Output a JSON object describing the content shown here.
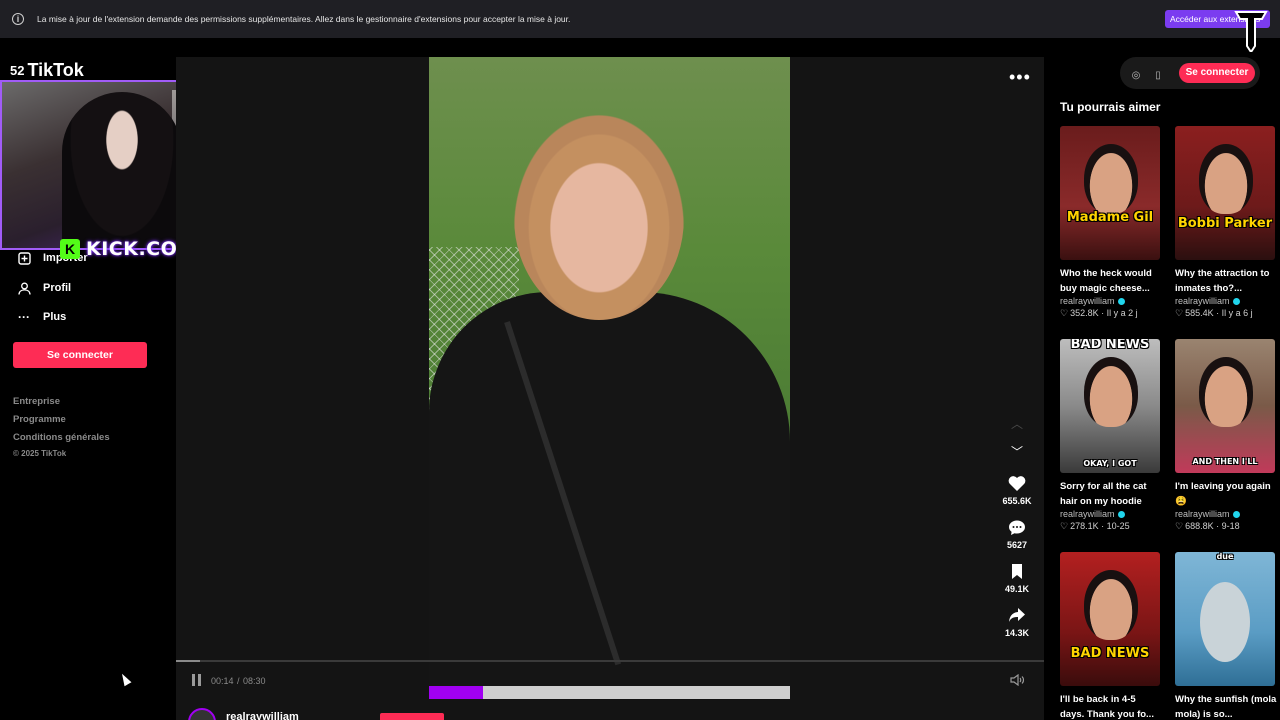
{
  "infobar": {
    "icon": "info-icon",
    "message": "La mise à jour de l'extension demande des permissions supplémentaires. Allez dans le gestionnaire d'extensions pour accepter la mise à jour.",
    "button_label": "Accéder aux extensions"
  },
  "sidebar": {
    "count": "52",
    "logo": "TikTok",
    "items": [
      {
        "label": "Importer",
        "icon": "plus-square-icon"
      },
      {
        "label": "Profil",
        "icon": "person-icon"
      },
      {
        "label": "Plus",
        "icon": "more-dots-icon"
      }
    ],
    "login_label": "Se connecter",
    "footer_links": [
      "Entreprise",
      "Programme",
      "Conditions générales"
    ],
    "copyright": "© 2025 TikTok"
  },
  "webcam": {
    "tag": "KICK.COM/ZARIEE",
    "kick_glyph": "K"
  },
  "player": {
    "time_current": "00:14",
    "time_sep": "/",
    "time_total": "08:30",
    "progress": 0.028,
    "overlay_progress": 0.15,
    "actions": [
      {
        "icon": "heart-icon",
        "count": "655.6K"
      },
      {
        "icon": "comment-icon",
        "count": "5627"
      },
      {
        "icon": "bookmark-icon",
        "count": "49.1K"
      },
      {
        "icon": "share-icon",
        "count": "14.3K"
      }
    ],
    "author": "realraywilliam"
  },
  "right_panel": {
    "login_label": "Se connecter",
    "section_title": "Tu pourrais aimer",
    "videos": [
      {
        "thumb_text": "Madame Gil",
        "title": "Who the heck would buy magic cheese...",
        "author": "realraywilliam",
        "likes": "352.8K",
        "date": "Il y a 2 j"
      },
      {
        "thumb_text": "Bobbi Parker",
        "title": "Why the attraction to inmates tho?...",
        "author": "realraywilliam",
        "likes": "585.4K",
        "date": "Il y a 6 j"
      },
      {
        "thumb_text": "BAD NEWS",
        "thumb_sub": "OKAY, I GOT",
        "title": "Sorry for all the cat hair on my hoodie",
        "author": "realraywilliam",
        "likes": "278.1K",
        "date": "10-25"
      },
      {
        "thumb_text": "AND THEN I'LL",
        "title": "I'm leaving you again 😩",
        "author": "realraywilliam",
        "likes": "688.8K",
        "date": "9-18"
      },
      {
        "thumb_text": "BAD NEWS",
        "title": "I'll be back in 4-5 days. Thank you fo...",
        "author": "realraywilliam"
      },
      {
        "thumb_text": "due",
        "title": "Why the sunfish (mola mola) is so...",
        "author": "realraywilliam"
      }
    ]
  }
}
